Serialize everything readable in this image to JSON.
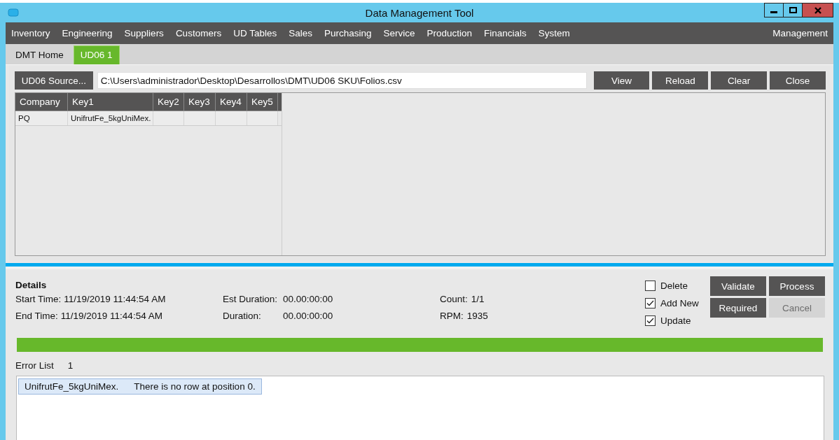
{
  "window": {
    "title": "Data Management Tool"
  },
  "menu": {
    "items": [
      "Inventory",
      "Engineering",
      "Suppliers",
      "Customers",
      "UD Tables",
      "Sales",
      "Purchasing",
      "Service",
      "Production",
      "Financials",
      "System"
    ],
    "right": "Management"
  },
  "tabs": [
    {
      "label": "DMT Home",
      "selected": false
    },
    {
      "label": "UD06 1",
      "selected": true
    }
  ],
  "toolbar": {
    "source_button": "UD06 Source...",
    "path": "C:\\Users\\administrador\\Desktop\\Desarrollos\\DMT\\UD06 SKU\\Folios.csv",
    "buttons": [
      "View",
      "Reload",
      "Clear",
      "Close"
    ]
  },
  "table": {
    "columns": [
      "Company",
      "Key1",
      "Key2",
      "Key3",
      "Key4",
      "Key5"
    ],
    "rows": [
      [
        "PQ",
        "UnifrutFe_5kgUniMex.",
        "",
        "",
        "",
        ""
      ]
    ]
  },
  "details": {
    "title": "Details",
    "fields": [
      {
        "label": "Start Time:",
        "value": "11/19/2019 11:44:54 AM"
      },
      {
        "label": "Est Duration:",
        "value": "00.00:00:00"
      },
      {
        "label": "Count:",
        "value": "1/1"
      },
      {
        "label": "End Time:",
        "value": "11/19/2019 11:44:54 AM"
      },
      {
        "label": "Duration:",
        "value": "00.00:00:00"
      },
      {
        "label": "RPM:",
        "value": "1935"
      }
    ],
    "options": [
      {
        "label": "Delete",
        "checked": false
      },
      {
        "label": "Add New",
        "checked": true
      },
      {
        "label": "Update",
        "checked": true
      }
    ],
    "buttons": [
      {
        "label": "Validate",
        "disabled": false
      },
      {
        "label": "Process",
        "disabled": false
      },
      {
        "label": "Required",
        "disabled": false
      },
      {
        "label": "Cancel",
        "disabled": true
      }
    ],
    "progress": {
      "level": 1
    }
  },
  "error_list": {
    "label": "Error List",
    "count": "1",
    "items": [
      {
        "key": "UnifrutFe_5kgUniMex.",
        "message": "There is no row at position 0.",
        "selected": true
      }
    ]
  }
}
